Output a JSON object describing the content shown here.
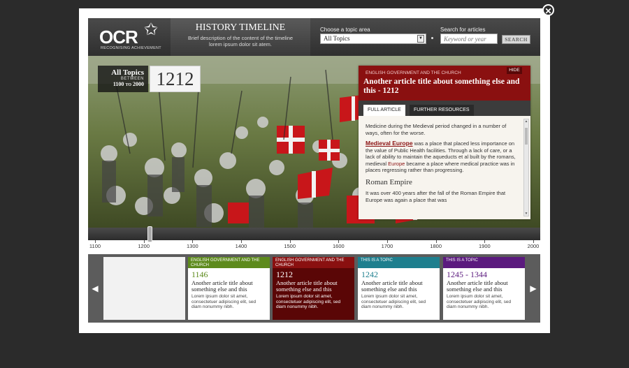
{
  "logo": {
    "word": "OCR",
    "tagline": "RECOGNISING ACHIEVEMENT"
  },
  "header": {
    "title": "HISTORY TIMELINE",
    "description_line1": "Brief description of the content of the timeline",
    "description_line2": "lorem ipsum dolor sit atem.",
    "topic_label": "Choose a topic area",
    "topic_selected": "All Topics",
    "search_label": "Search for articles",
    "search_placeholder": "Keyword or year",
    "search_button": "SEARCH"
  },
  "range": {
    "topic": "All Topics",
    "between": "BETWEEN",
    "from": "1100",
    "to_word": "TO",
    "to": "2000"
  },
  "current_year": "1212",
  "article": {
    "category": "ENGLISH GOVERNMENT AND THE CHURCH",
    "hide": "HIDE",
    "title": "Another article title about something else and this - 1212",
    "tabs": [
      "FULL ARTICLE",
      "FURTHER RESOURCES"
    ],
    "intro": "Medicine during the Medieval period changed in a number of ways, often for the worse.",
    "link_text": "Medieval Europe",
    "para2_rest": " was a place that placed less importance on the value of Public Health facilities. Through a lack of care, or a lack of ability to maintain the aqueducts et al built by the romans, medieval ",
    "para2_red": "Europe",
    "para2_end": " became a place where medical practice was in places regressing rather than progressing.",
    "subheading": "Roman Empire",
    "para3": "It was over 400 years after the fall of the Roman Empire that Europe was again a place that was"
  },
  "timeline": {
    "labels": [
      "1100",
      "1200",
      "1300",
      "1400",
      "1500",
      "1600",
      "1700",
      "1800",
      "1900",
      "2000"
    ],
    "position_year": 1212
  },
  "cards": [
    {
      "category": "ENGLISH GOVERNMENT AND THE CHURCH",
      "year": "1146",
      "title": "Another article title about something else and this",
      "desc": "Lorem ipsum dolor sit amet, consectetuer adipiscing elit, sed diam nonummy nibh.",
      "color": "#5d8a1c",
      "year_color": "#5d8a1c"
    },
    {
      "category": "ENGLISH GOVERNMENT AND THE CHURCH",
      "year": "1212",
      "title": "Another article title about something else and this",
      "desc": "Lorem ipsum dolor sit amet, consectetuer adipiscing elit, sed diam nonummy nibh.",
      "color": "#8a1010",
      "year_color": "#ffffff"
    },
    {
      "category": "THIS IS A TOPIC",
      "year": "1242",
      "title": "Another article title about something else and this",
      "desc": "Lorem ipsum dolor sit amet, consectetuer adipiscing elit, sed diam nonummy nibh.",
      "color": "#1e7f8e",
      "year_color": "#1e7f8e"
    },
    {
      "category": "THIS IS A TOPIC",
      "year": "1245 - 1344",
      "title": "Another article title about something else and this",
      "desc": "Lorem ipsum dolor sit amet, consectetuer adipiscing elit, sed diam nonummy nibh.",
      "color": "#5b1a7e",
      "year_color": "#5b1a7e"
    }
  ],
  "colors": {
    "accent_red": "#8a1010",
    "header_dark": "#3a3a3a"
  }
}
